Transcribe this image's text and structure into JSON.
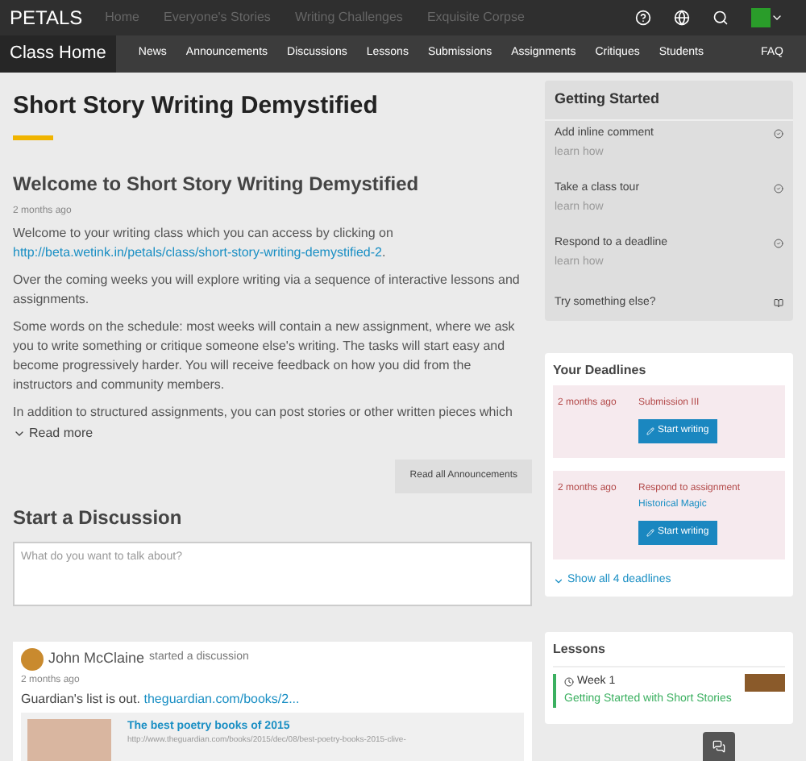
{
  "topbar": {
    "logo": "PETALS",
    "links": [
      "Home",
      "Everyone's Stories",
      "Writing Challenges",
      "Exquisite Corpse"
    ]
  },
  "nav": {
    "items": [
      {
        "label": "Class Home",
        "selected": true
      },
      {
        "label": "News",
        "selected": false
      },
      {
        "label": "Announcements",
        "selected": false
      },
      {
        "label": "Discussions",
        "selected": false
      },
      {
        "label": "Lessons",
        "selected": false
      },
      {
        "label": "Submissions",
        "selected": false
      },
      {
        "label": "Assignments",
        "selected": false
      },
      {
        "label": "Critiques",
        "selected": false
      },
      {
        "label": "Students",
        "selected": false
      }
    ],
    "faq": "FAQ"
  },
  "page_title": "Short Story Writing Demystified",
  "announcement": {
    "title": "Welcome to Short Story Writing Demystified",
    "time": "2 months ago",
    "intro": "Welcome to your writing class which you can access by clicking on",
    "link": "http://beta.wetink.in/petals/class/short-story-writing-demystified-2",
    "link_suffix": ".",
    "paragraphs": [
      "Over the coming weeks you will explore writing via a sequence of interactive lessons and assignments.",
      "Some words on the schedule: most weeks will contain a new assignment, where we ask you to write something or critique someone else's writing. The tasks will start easy and become progressively harder. You will receive feedback on how you did from the instructors and community members.",
      "In addition to structured assignments, you can post stories or other written pieces which"
    ],
    "read_more": "Read more",
    "read_all": "Read all Announcements"
  },
  "discussion": {
    "title": "Start a Discussion",
    "placeholder": "What do you want to talk about?"
  },
  "post": {
    "author": "John McClaine",
    "action": "started a discussion",
    "time": "2 months ago",
    "text": "Guardian's list is out.",
    "link": "theguardian.com/books/2...",
    "preview_title": "The best poetry books of 2015",
    "preview_url": "http://www.theguardian.com/books/2015/dec/08/best-poetry-books-2015-clive-"
  },
  "getting_started": {
    "title": "Getting Started",
    "items": [
      {
        "label": "Add inline comment",
        "hint": "learn how"
      },
      {
        "label": "Take a class tour",
        "hint": "learn how"
      },
      {
        "label": "Respond to a deadline",
        "hint": "learn how"
      }
    ],
    "more": "Try something else?"
  },
  "deadlines": {
    "title": "Your Deadlines",
    "items": [
      {
        "time": "2 months ago",
        "label": "Submission III",
        "button": "Start writing"
      },
      {
        "time": "2 months ago",
        "label": "Respond to assignment",
        "link": "Historical Magic",
        "button": "Start writing"
      }
    ],
    "show_all": "Show all 4 deadlines"
  },
  "lessons": {
    "title": "Lessons",
    "items": [
      {
        "week": "Week 1",
        "title": "Getting Started with Short Stories"
      }
    ]
  }
}
